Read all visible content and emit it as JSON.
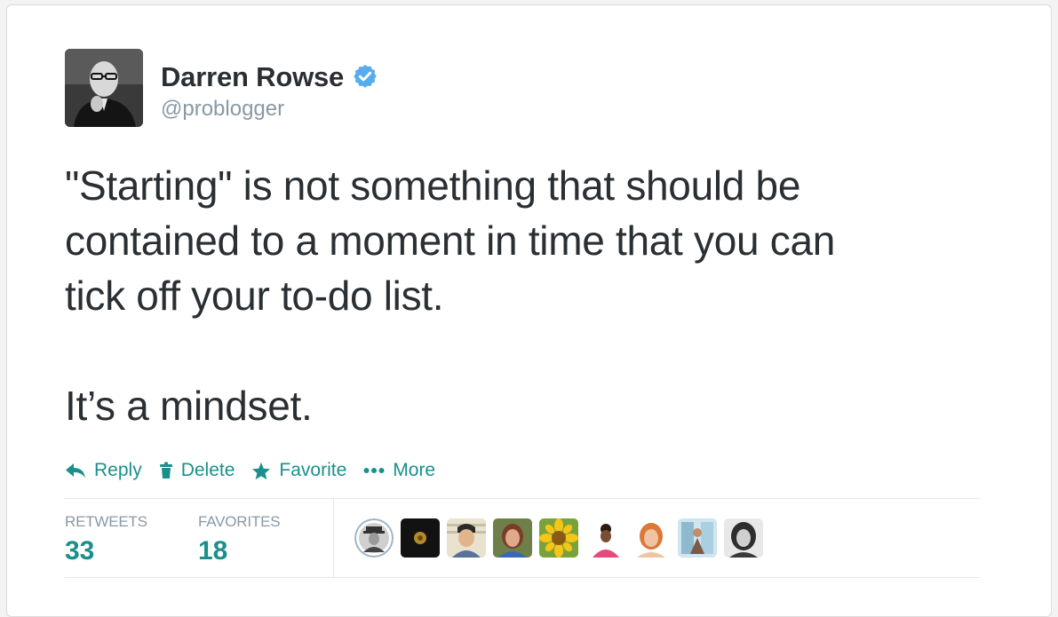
{
  "author": {
    "display_name": "Darren Rowse",
    "handle": "@problogger",
    "verified": true,
    "verified_icon": "verified-badge-icon",
    "verified_color": "#55acee"
  },
  "tweet": {
    "paragraph_1_line_1": "\"Starting\" is not something that should be",
    "paragraph_1_line_2": "contained to a moment in time that you can",
    "paragraph_1_line_3": "tick off your to-do list.",
    "paragraph_2": "It’s a mindset."
  },
  "actions": {
    "reply_label": "Reply",
    "delete_label": "Delete",
    "favorite_label": "Favorite",
    "more_label": "More",
    "icons": [
      "reply-arrow-icon",
      "trash-icon",
      "star-icon",
      "ellipsis-icon"
    ],
    "color": "#1b8f8b"
  },
  "stats": {
    "retweets_label": "RETWEETS",
    "retweets_count": "33",
    "favorites_label": "FAVORITES",
    "favorites_count": "18"
  },
  "favoriters_count_shown": 9
}
